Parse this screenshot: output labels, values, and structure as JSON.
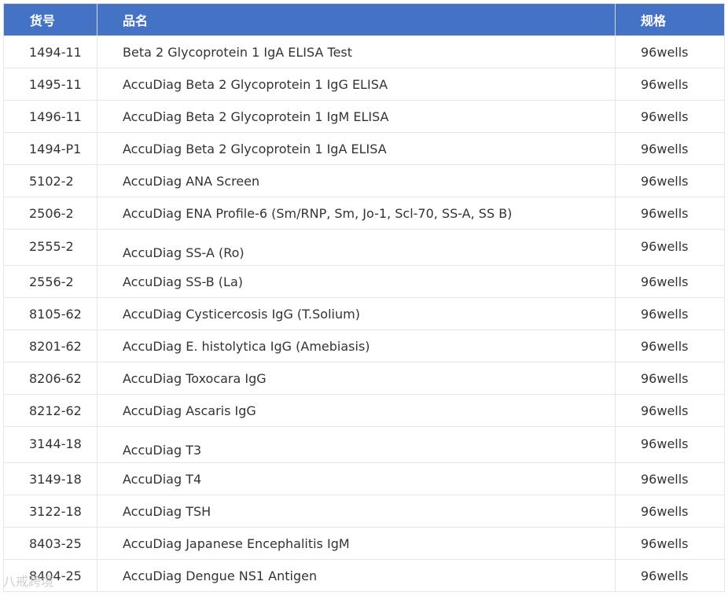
{
  "table": {
    "headers": [
      "货号",
      "品名",
      "规格"
    ],
    "rows": [
      {
        "code": "1494-11",
        "name": "Beta 2 Glycoprotein 1 IgA ELISA Test",
        "spec": "96wells"
      },
      {
        "code": "1495-11",
        "name": "AccuDiag Beta 2 Glycoprotein 1 IgG ELISA",
        "spec": "96wells"
      },
      {
        "code": "1496-11",
        "name": "AccuDiag Beta 2 Glycoprotein 1 IgM ELISA",
        "spec": "96wells"
      },
      {
        "code": "1494-P1",
        "name": "AccuDiag Beta 2 Glycoprotein 1 IgA ELISA",
        "spec": "96wells"
      },
      {
        "code": "5102-2",
        "name": "AccuDiag ANA Screen",
        "spec": "96wells"
      },
      {
        "code": "2506-2",
        "name": "AccuDiag ENA Profile-6 (Sm/RNP, Sm, Jo-1, Scl-70, SS-A, SS B)",
        "spec": "96wells"
      },
      {
        "code": "2555-2",
        "name": "AccuDiag SS-A (Ro)",
        "spec": "96wells"
      },
      {
        "code": "2556-2",
        "name": "AccuDiag SS-B (La)",
        "spec": "96wells"
      },
      {
        "code": "8105-62",
        "name": "AccuDiag Cysticercosis IgG (T.Solium)",
        "spec": "96wells"
      },
      {
        "code": "8201-62",
        "name": "AccuDiag E. histolytica IgG (Amebiasis)",
        "spec": "96wells"
      },
      {
        "code": "8206-62",
        "name": "AccuDiag Toxocara IgG",
        "spec": "96wells"
      },
      {
        "code": "8212-62",
        "name": "AccuDiag Ascaris IgG",
        "spec": "96wells"
      },
      {
        "code": "3144-18",
        "name": "AccuDiag T3",
        "spec": "96wells"
      },
      {
        "code": "3149-18",
        "name": "AccuDiag T4",
        "spec": "96wells"
      },
      {
        "code": "3122-18",
        "name": "AccuDiag TSH",
        "spec": "96wells"
      },
      {
        "code": "8403-25",
        "name": "AccuDiag Japanese Encephalitis IgM",
        "spec": "96wells"
      },
      {
        "code": "8404-25",
        "name": "AccuDiag Dengue NS1 Antigen",
        "spec": "96wells"
      }
    ]
  },
  "watermark": "八戒跨境"
}
